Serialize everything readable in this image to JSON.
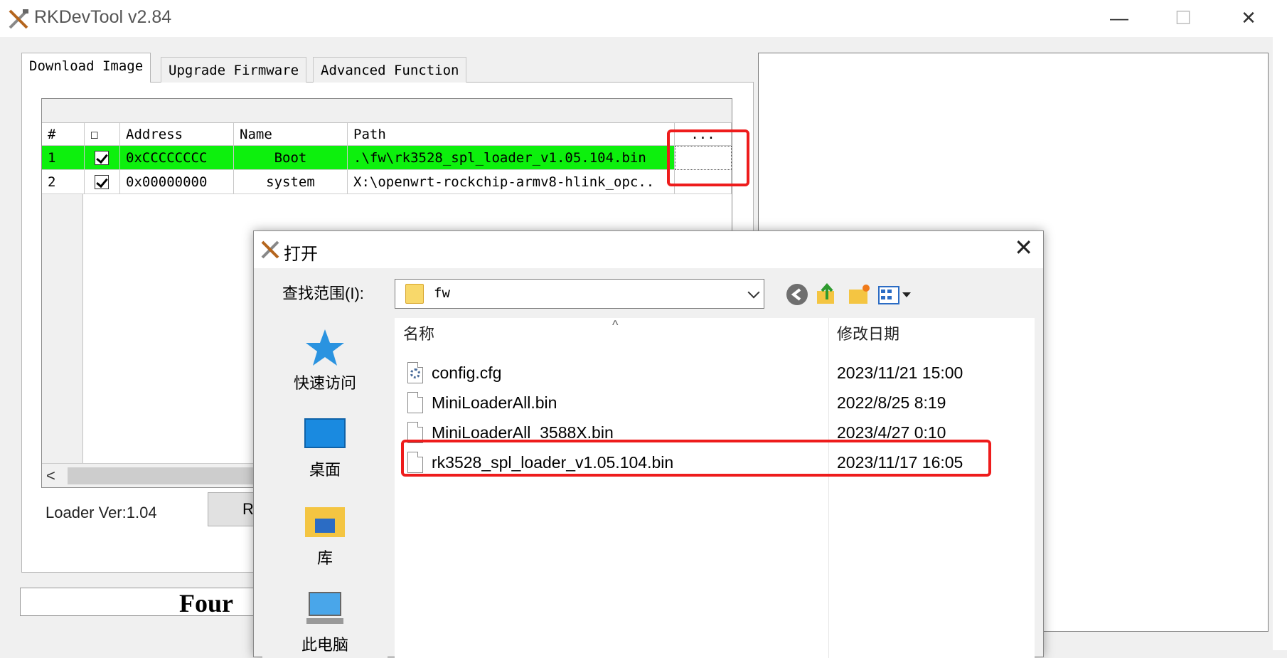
{
  "app": {
    "title": "RKDevTool v2.84",
    "window_buttons": {
      "minimize": "—",
      "maximize": "☐",
      "close": "✕"
    }
  },
  "tabs": [
    {
      "label": "Download Image",
      "active": true
    },
    {
      "label": "Upgrade Firmware",
      "active": false
    },
    {
      "label": "Advanced Function",
      "active": false
    }
  ],
  "image_table": {
    "columns": [
      "#",
      "☐",
      "Address",
      "Name",
      "Path",
      "..."
    ],
    "rows": [
      {
        "index": "1",
        "checked": true,
        "address": "0xCCCCCCCC",
        "name": "Boot",
        "path": ".\\fw\\rk3528_spl_loader_v1.05.104.bin",
        "highlighted": true
      },
      {
        "index": "2",
        "checked": true,
        "address": "0x00000000",
        "name": "system",
        "path": "X:\\openwrt-rockchip-armv8-hlink_opc..",
        "highlighted": false
      }
    ],
    "scroll_left": "<"
  },
  "loader_version": "Loader Ver:1.04",
  "button_partial": "R",
  "status_text": "Four",
  "dialog": {
    "title": "打开",
    "close": "✕",
    "look_in_label": "查找范围(I):",
    "look_in_value": "fw",
    "places": [
      {
        "label": "快速访问",
        "icon": "star-icon"
      },
      {
        "label": "桌面",
        "icon": "desktop-icon"
      },
      {
        "label": "库",
        "icon": "library-icon"
      },
      {
        "label": "此电脑",
        "icon": "computer-icon"
      }
    ],
    "headers": {
      "name": "名称",
      "modified": "修改日期"
    },
    "files": [
      {
        "name": "config.cfg",
        "modified": "2023/11/21 15:00",
        "icon": "config-file-icon"
      },
      {
        "name": "MiniLoaderAll.bin",
        "modified": "2022/8/25 8:19",
        "icon": "file-icon"
      },
      {
        "name": "MiniLoaderAll_3588X.bin",
        "modified": "2023/4/27 0:10",
        "icon": "file-icon"
      },
      {
        "name": "rk3528_spl_loader_v1.05.104.bin",
        "modified": "2023/11/17 16:05",
        "icon": "file-icon"
      }
    ]
  },
  "colors": {
    "row_highlight": "#0df00d",
    "annotation_red": "#ee1c1c"
  }
}
